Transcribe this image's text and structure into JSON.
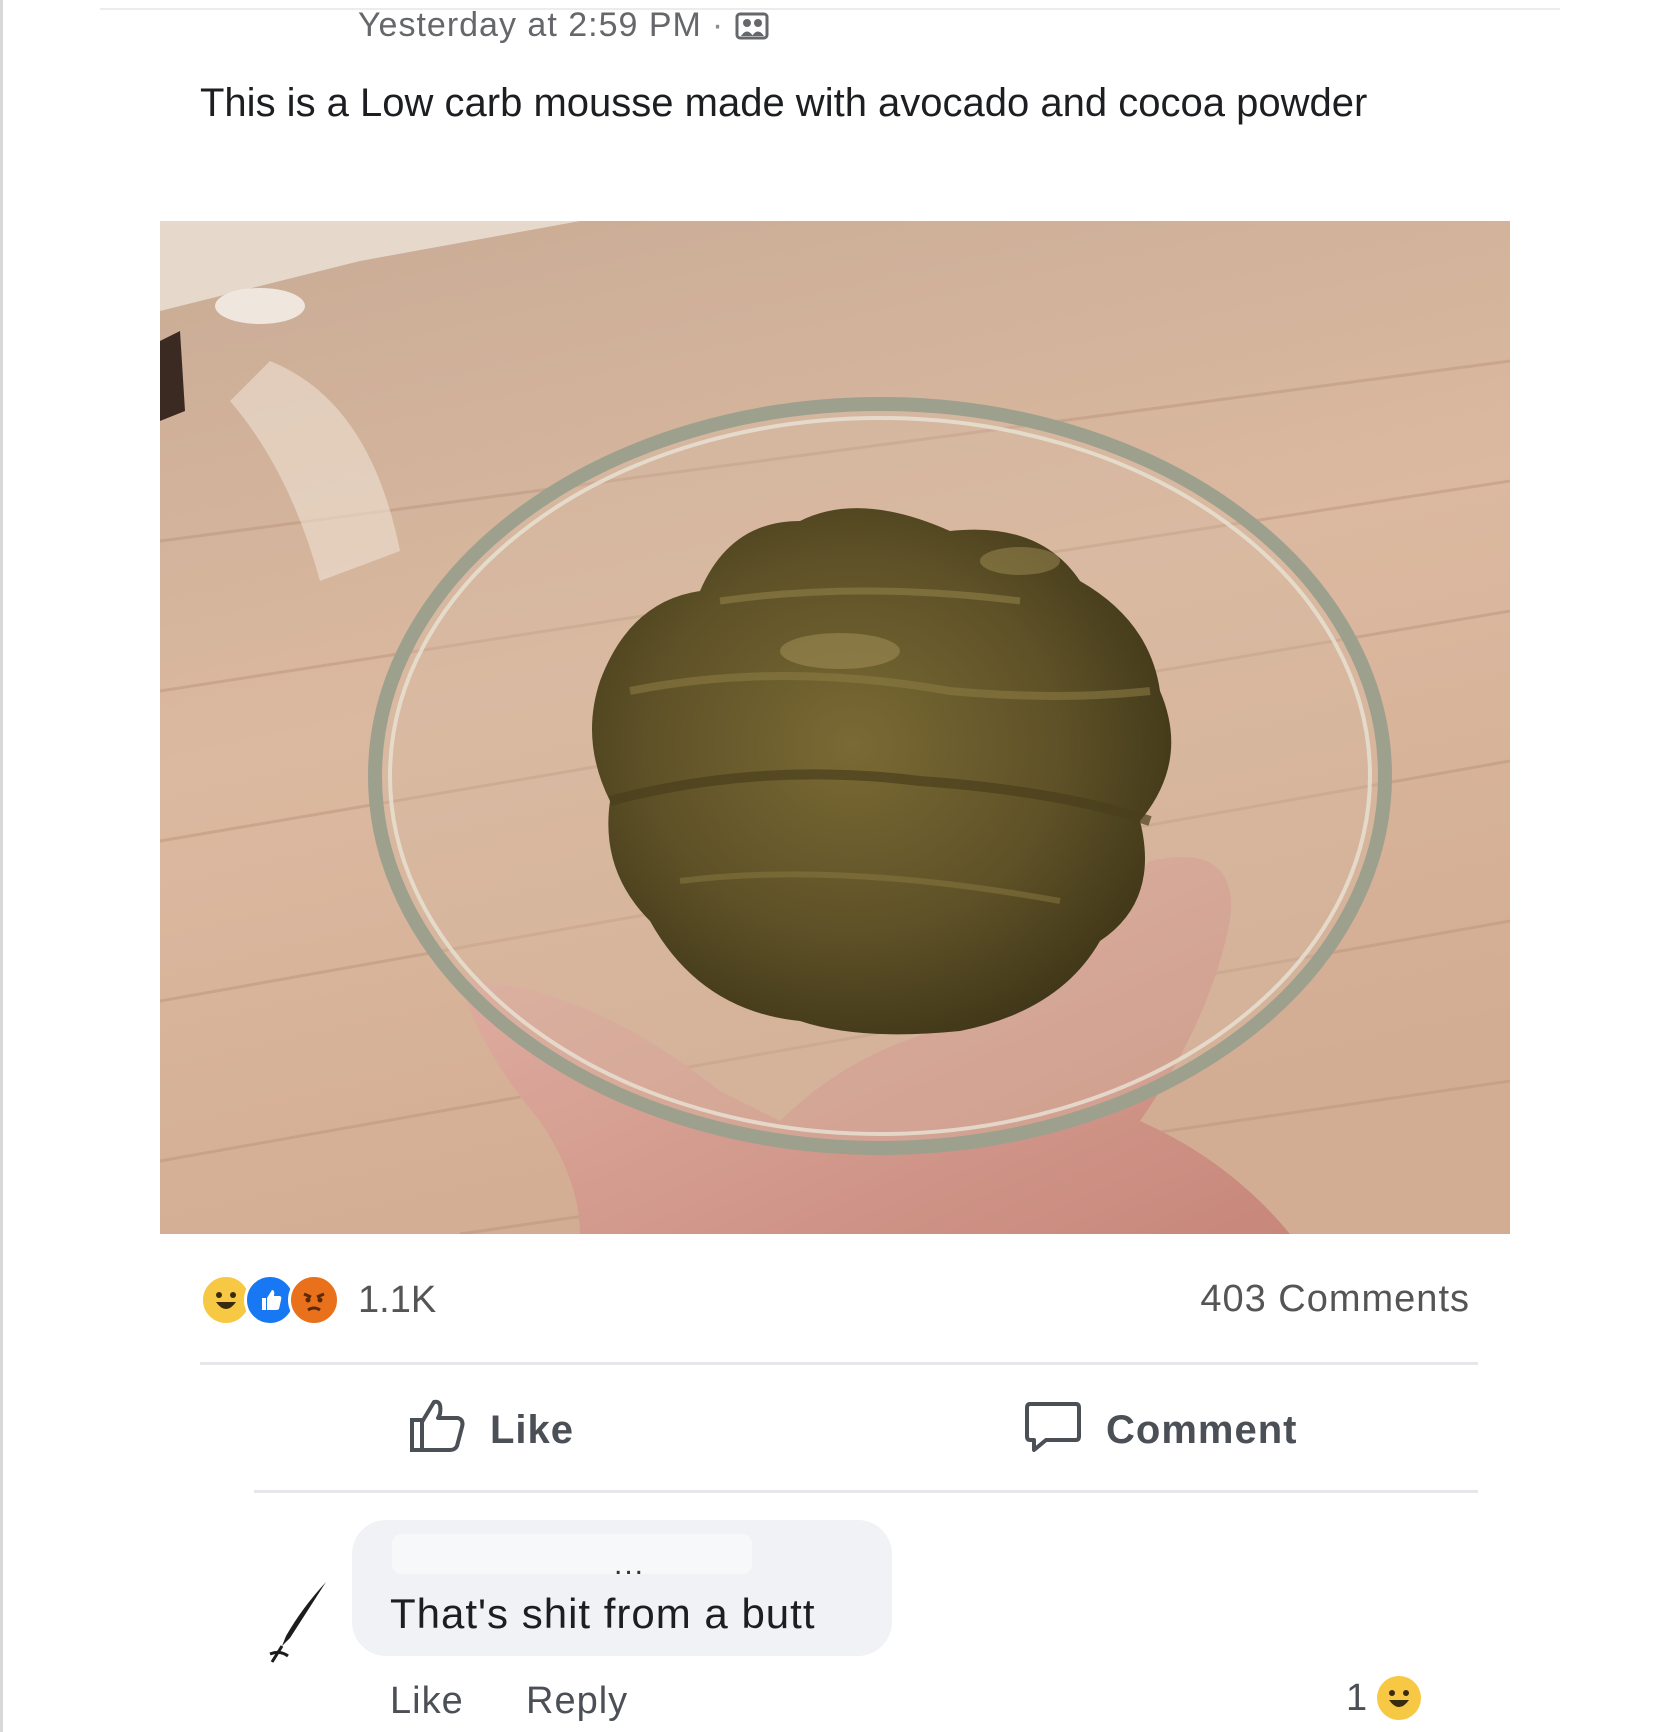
{
  "post": {
    "timestamp": "Yesterday at 2:59 PM",
    "separator": "·",
    "privacy_icon": "friends-icon",
    "text": "This is a Low carb mousse made with avocado and cocoa powder",
    "photo_icon": "photo-of-mousse-in-glass-bowl"
  },
  "stats": {
    "reaction_icons": [
      "haha-reaction-icon",
      "like-reaction-icon",
      "angry-reaction-icon"
    ],
    "reaction_count": "1.1K",
    "comment_count": "403 Comments"
  },
  "actions": {
    "like_label": "Like",
    "comment_label": "Comment"
  },
  "comment": {
    "avatar_icon": "pen-avatar-icon",
    "dots": "...",
    "text": "That's shit from a butt",
    "like_label": "Like",
    "reply_label": "Reply",
    "reaction_count": "1",
    "reaction_icon": "haha-reaction-icon"
  },
  "colors": {
    "accent_blue": "#1877f2",
    "haha_yellow": "#f7c843",
    "angry_orange": "#e9711c",
    "text_secondary": "#65676b"
  }
}
